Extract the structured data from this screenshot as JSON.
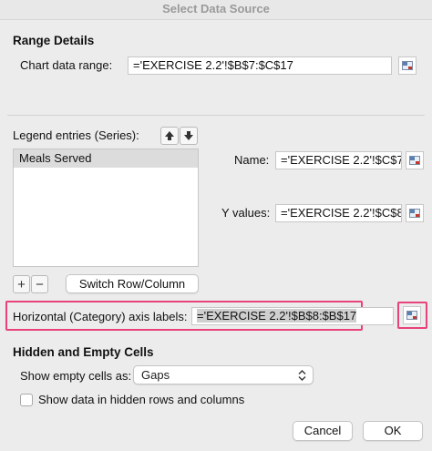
{
  "window": {
    "title": "Select Data Source"
  },
  "range_details": {
    "heading": "Range Details",
    "chart_data_range_label": "Chart data range:",
    "chart_data_range_value": "='EXERCISE 2.2'!$B$7:$C$17"
  },
  "legend": {
    "heading": "Legend entries (Series):",
    "series": [
      "Meals Served"
    ],
    "selected_index": 0,
    "move_up_icon": "arrow-up-icon",
    "move_down_icon": "arrow-down-icon",
    "add_symbol": "+",
    "remove_symbol": "−",
    "switch_button": "Switch Row/Column"
  },
  "series_detail": {
    "name_label": "Name:",
    "name_value": "='EXERCISE 2.2'!$C$7",
    "y_values_label": "Y values:",
    "y_values_value": "='EXERCISE 2.2'!$C$8:$"
  },
  "category_axis": {
    "label": "Horizontal (Category) axis labels:",
    "value": "='EXERCISE 2.2'!$B$8:$B$17"
  },
  "hidden_empty": {
    "heading": "Hidden and Empty Cells",
    "show_empty_label": "Show empty cells as:",
    "show_empty_value": "Gaps",
    "hidden_rows_label": "Show data in hidden rows and columns",
    "hidden_rows_checked": false
  },
  "buttons": {
    "cancel": "Cancel",
    "ok": "OK"
  },
  "colors": {
    "highlight": "#e8427a",
    "background": "#ececec"
  }
}
